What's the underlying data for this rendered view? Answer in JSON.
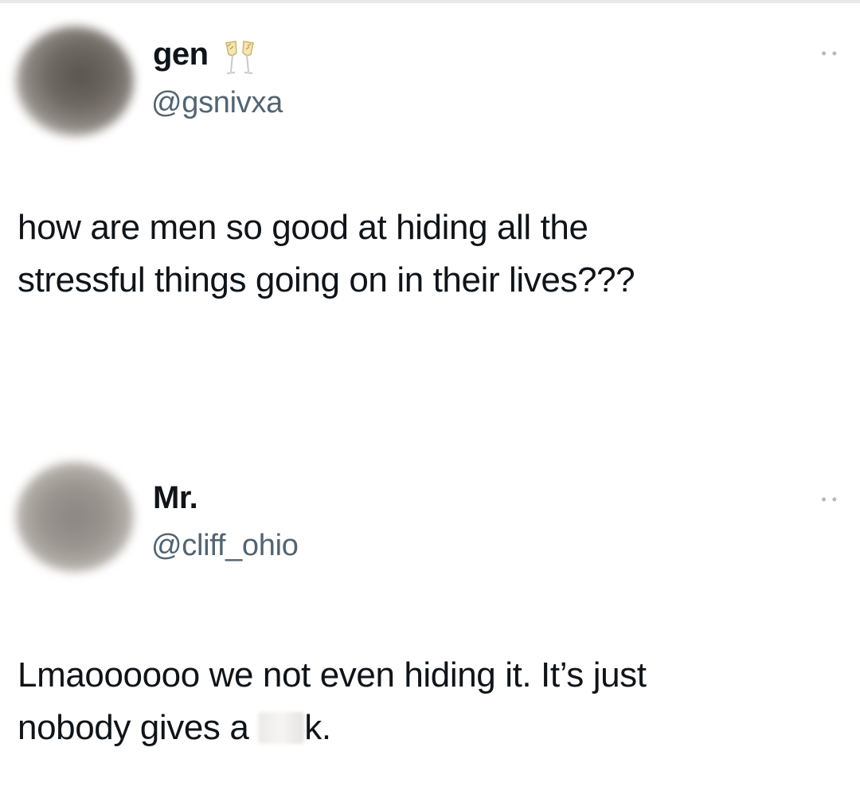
{
  "tweets": [
    {
      "display_name": "gen",
      "name_emoji": "clinking-glasses-icon",
      "handle": "@gsnivxa",
      "more_icon": "more-options-icon",
      "text_lines": [
        "how are men so good at hiding all the",
        "stressful things going on in their lives???"
      ]
    },
    {
      "display_name": "Mr.",
      "handle": "@cliff_ohio",
      "more_icon": "more-options-icon",
      "text_line_1": "Lmaoooooo we not even hiding it. It’s just",
      "text_line_2_before": "nobody gives a ",
      "text_line_2_censored": "blurred-word",
      "text_line_2_after": "k."
    }
  ],
  "colors": {
    "text": "#0f1419",
    "handle": "#536471",
    "background": "#ffffff"
  }
}
